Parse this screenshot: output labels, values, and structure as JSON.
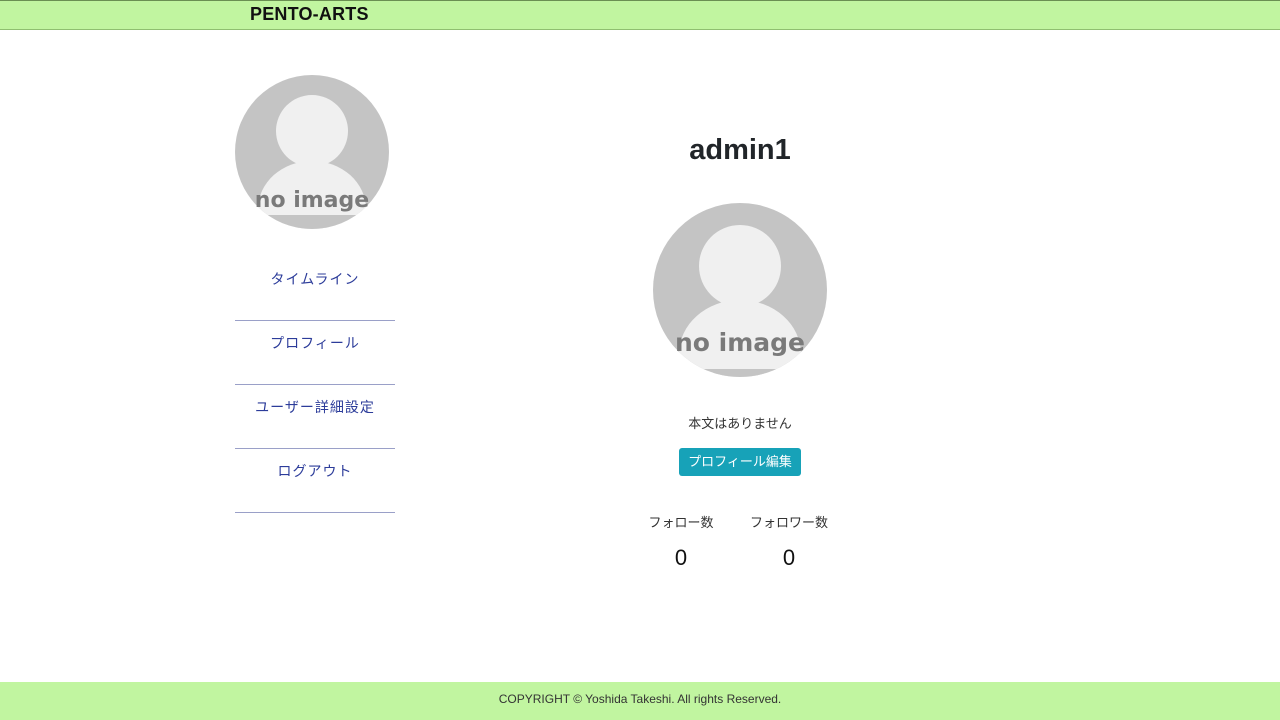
{
  "header": {
    "brand": "PENTO-ARTS"
  },
  "sidebar": {
    "avatar_text": "no image",
    "items": [
      {
        "label": "タイムライン"
      },
      {
        "label": "プロフィール"
      },
      {
        "label": "ユーザー詳細設定"
      },
      {
        "label": "ログアウト"
      }
    ]
  },
  "profile": {
    "username": "admin1",
    "avatar_text": "no image",
    "body_text": "本文はありません",
    "edit_button": "プロフィール編集",
    "follow_label": "フォロー数",
    "follow_count": "0",
    "follower_label": "フォロワー数",
    "follower_count": "0"
  },
  "footer": {
    "copyright": "COPYRIGHT © Yoshida Takeshi. All rights Reserved."
  },
  "colors": {
    "header_bg": "#c1f5a0",
    "footer_bg": "#c1f5a0",
    "nav_text": "#2c3c9a",
    "button_bg": "#17a2b8",
    "avatar_bg": "#c4c4c4",
    "avatar_figure": "#f0f0f0"
  }
}
